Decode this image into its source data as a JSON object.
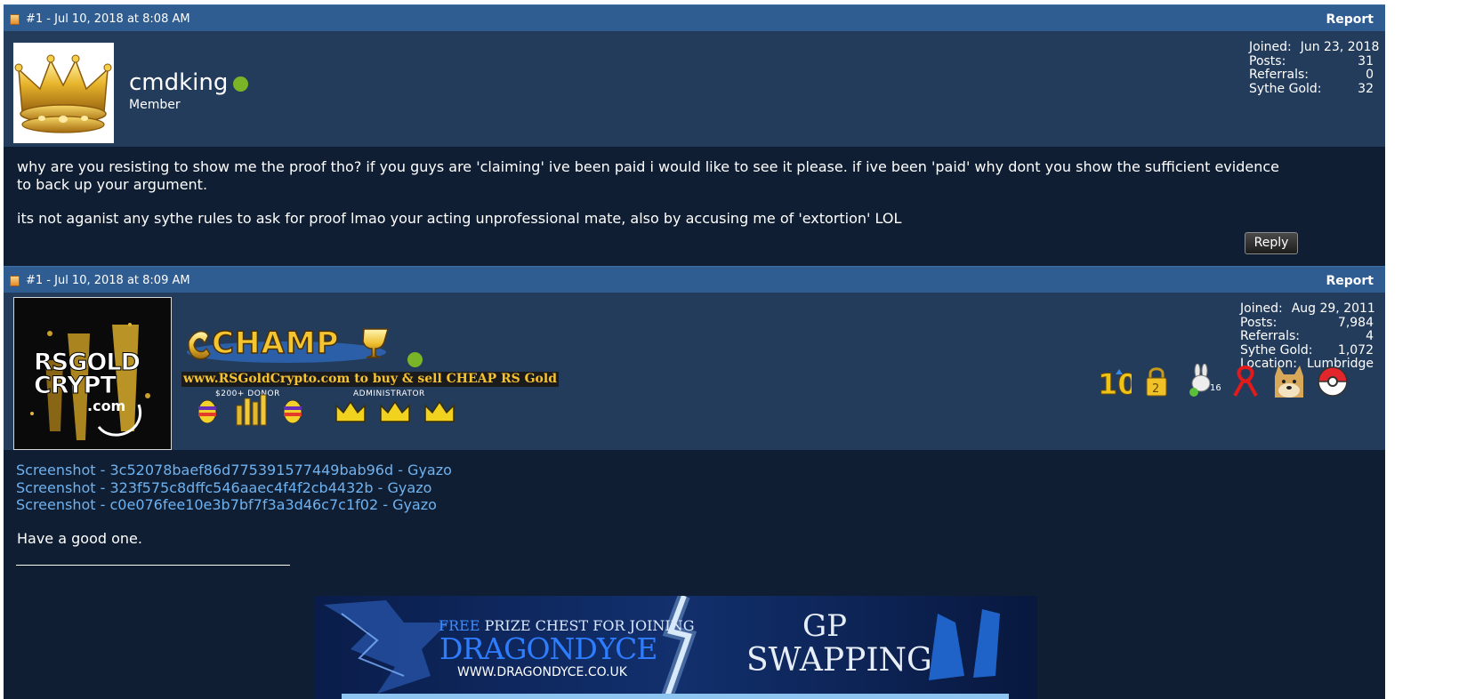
{
  "posts": [
    {
      "meta": "#1 - Jul 10, 2018 at 8:08 AM",
      "report_label": "Report",
      "username": "cmdking",
      "usertitle": "Member",
      "stats": [
        {
          "label": "Joined:",
          "value": "Jun 23, 2018"
        },
        {
          "label": "Posts:",
          "value": "31"
        },
        {
          "label": "Referrals:",
          "value": "0"
        },
        {
          "label": "Sythe Gold:",
          "value": "32"
        }
      ],
      "message": [
        "why are you resisting to show me the proof tho? if you guys are 'claiming' ive been paid i would like to see it please. if ive been 'paid' why dont you show the sufficient evidence to back up your argument.",
        "its not aganist any sythe rules to ask for proof lmao your acting unprofessional mate, also by accusing me of 'extortion' LOL"
      ],
      "reply_label": "Reply"
    },
    {
      "meta": "#1 - Jul 10, 2018 at 8:09 AM",
      "report_label": "Report",
      "avatar_text": {
        "line1": "RS",
        "line1b": "GOLD",
        "line2": "CRYPT",
        "line3": ".com"
      },
      "rank_banner": "CHAMP",
      "promo_text": "www.RSGoldCrypto.com to buy & sell CHEAP RS Gold",
      "badge_labels": {
        "donor": "$200+ DONOR",
        "admin": "ADMINISTRATOR"
      },
      "stats": [
        {
          "label": "Joined:",
          "value": "Aug 29, 2011"
        },
        {
          "label": "Posts:",
          "value": "7,984"
        },
        {
          "label": "Referrals:",
          "value": "4"
        },
        {
          "label": "Sythe Gold:",
          "value": "1,072"
        },
        {
          "label": "Location:",
          "value": "Lumbridge"
        }
      ],
      "trophy_icons": [
        "ten-year-icon",
        "lock-icon",
        "bunny-icon",
        "ribbon-icon",
        "doge-icon",
        "pokeball-icon"
      ],
      "links": [
        "Screenshot - 3c52078baef86d775391577449bab96d - Gyazo",
        "Screenshot - 323f575c8dffc546aaec4f4f2cb4432b - Gyazo",
        "Screenshot - c0e076fee10e3b7bf7f3a3d46c7c1f02 - Gyazo"
      ],
      "closing": "Have a good one.",
      "banner": {
        "free_prefix": "FREE",
        "free_text": " PRIZE CHEST FOR JOINING",
        "brand": "DRAGONDYCE",
        "url": "WWW.DRAGONDYCE.CO.UK",
        "right_line1": "GP",
        "right_line2": "SWAPPING"
      }
    }
  ],
  "colors": {
    "header_bar": "#2f5c91",
    "userbar": "#233c5c",
    "body_bg": "#0f1e33",
    "link": "#6fb2f0",
    "online": "#7ab528"
  }
}
